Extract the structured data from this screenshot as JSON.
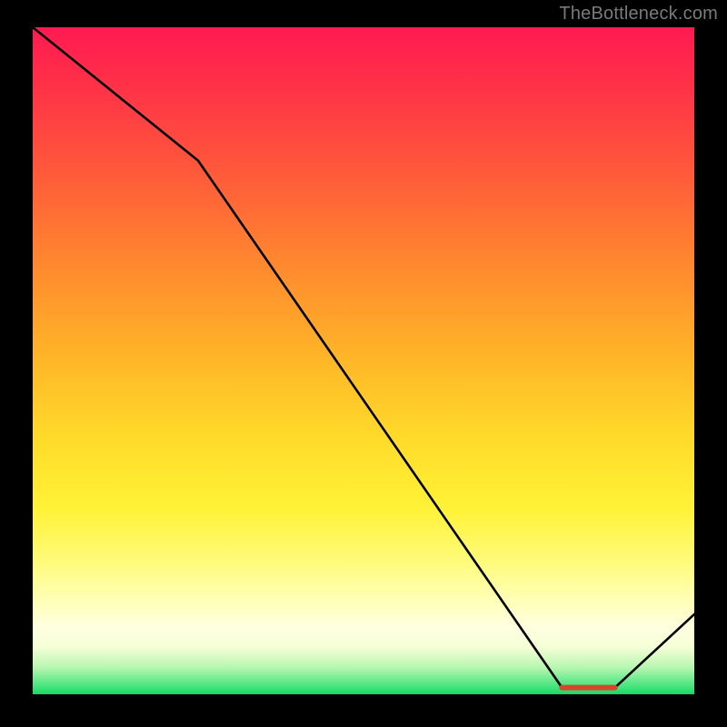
{
  "attribution": "TheBottleneck.com",
  "chart_data": {
    "type": "line",
    "title": "",
    "xlabel": "",
    "ylabel": "",
    "xlim": [
      0,
      100
    ],
    "ylim": [
      0,
      100
    ],
    "grid": false,
    "series": [
      {
        "name": "curve",
        "x": [
          0,
          25,
          80,
          88,
          100
        ],
        "values": [
          100,
          80,
          1,
          1,
          12
        ]
      }
    ],
    "marker_band": {
      "x_start": 80,
      "x_end": 88,
      "y": 1
    },
    "gradient_stops": [
      {
        "pct": 0,
        "color": "#ff1a52"
      },
      {
        "pct": 50,
        "color": "#ffb728"
      },
      {
        "pct": 80,
        "color": "#fffb7a"
      },
      {
        "pct": 100,
        "color": "#17d765"
      }
    ]
  }
}
